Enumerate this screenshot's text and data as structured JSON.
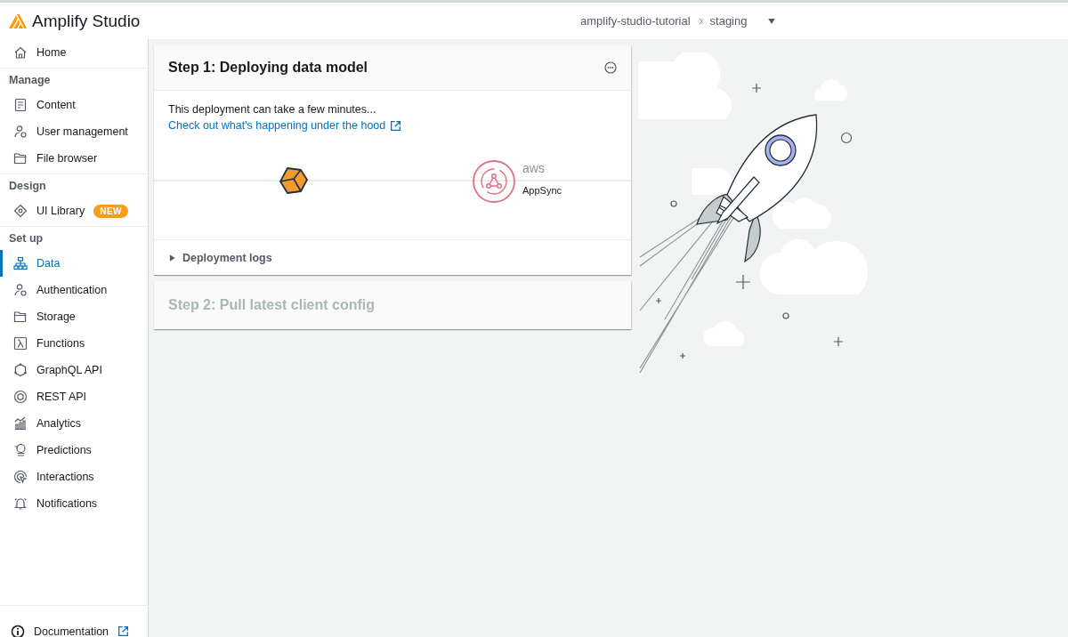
{
  "header": {
    "title": "Amplify Studio",
    "breadcrumb": [
      "amplify-studio-tutorial",
      "staging"
    ]
  },
  "sidebar": {
    "items": [
      {
        "kind": "link",
        "label": "Home",
        "selected": false
      },
      {
        "kind": "heading",
        "label": "Manage"
      },
      {
        "kind": "link",
        "label": "Content",
        "selected": false
      },
      {
        "kind": "link",
        "label": "User management",
        "selected": false
      },
      {
        "kind": "link",
        "label": "File browser",
        "selected": false
      },
      {
        "kind": "heading",
        "label": "Design"
      },
      {
        "kind": "link",
        "label": "UI Library",
        "selected": false,
        "badge": "NEW"
      },
      {
        "kind": "heading",
        "label": "Set up"
      },
      {
        "kind": "link",
        "label": "Data",
        "selected": true
      },
      {
        "kind": "link",
        "label": "Authentication",
        "selected": false
      },
      {
        "kind": "link",
        "label": "Storage",
        "selected": false
      },
      {
        "kind": "link",
        "label": "Functions",
        "selected": false
      },
      {
        "kind": "link",
        "label": "GraphQL API",
        "selected": false
      },
      {
        "kind": "link",
        "label": "REST API",
        "selected": false
      },
      {
        "kind": "link",
        "label": "Analytics",
        "selected": false
      },
      {
        "kind": "link",
        "label": "Predictions",
        "selected": false
      },
      {
        "kind": "link",
        "label": "Interactions",
        "selected": false
      },
      {
        "kind": "link",
        "label": "Notifications",
        "selected": false
      }
    ],
    "footer": {
      "label": "Documentation"
    }
  },
  "steps": [
    {
      "title": "Step 1: Deploying data model",
      "disabled": false,
      "text": "This deployment can take a few minutes...",
      "link": "Check out what's happening under the hood",
      "diagram": {
        "brand": "aws",
        "service": "AppSync"
      },
      "logs": {
        "label": "Deployment logs",
        "expanded": false
      }
    },
    {
      "title": "Step 2: Pull latest client config",
      "disabled": true
    }
  ]
}
